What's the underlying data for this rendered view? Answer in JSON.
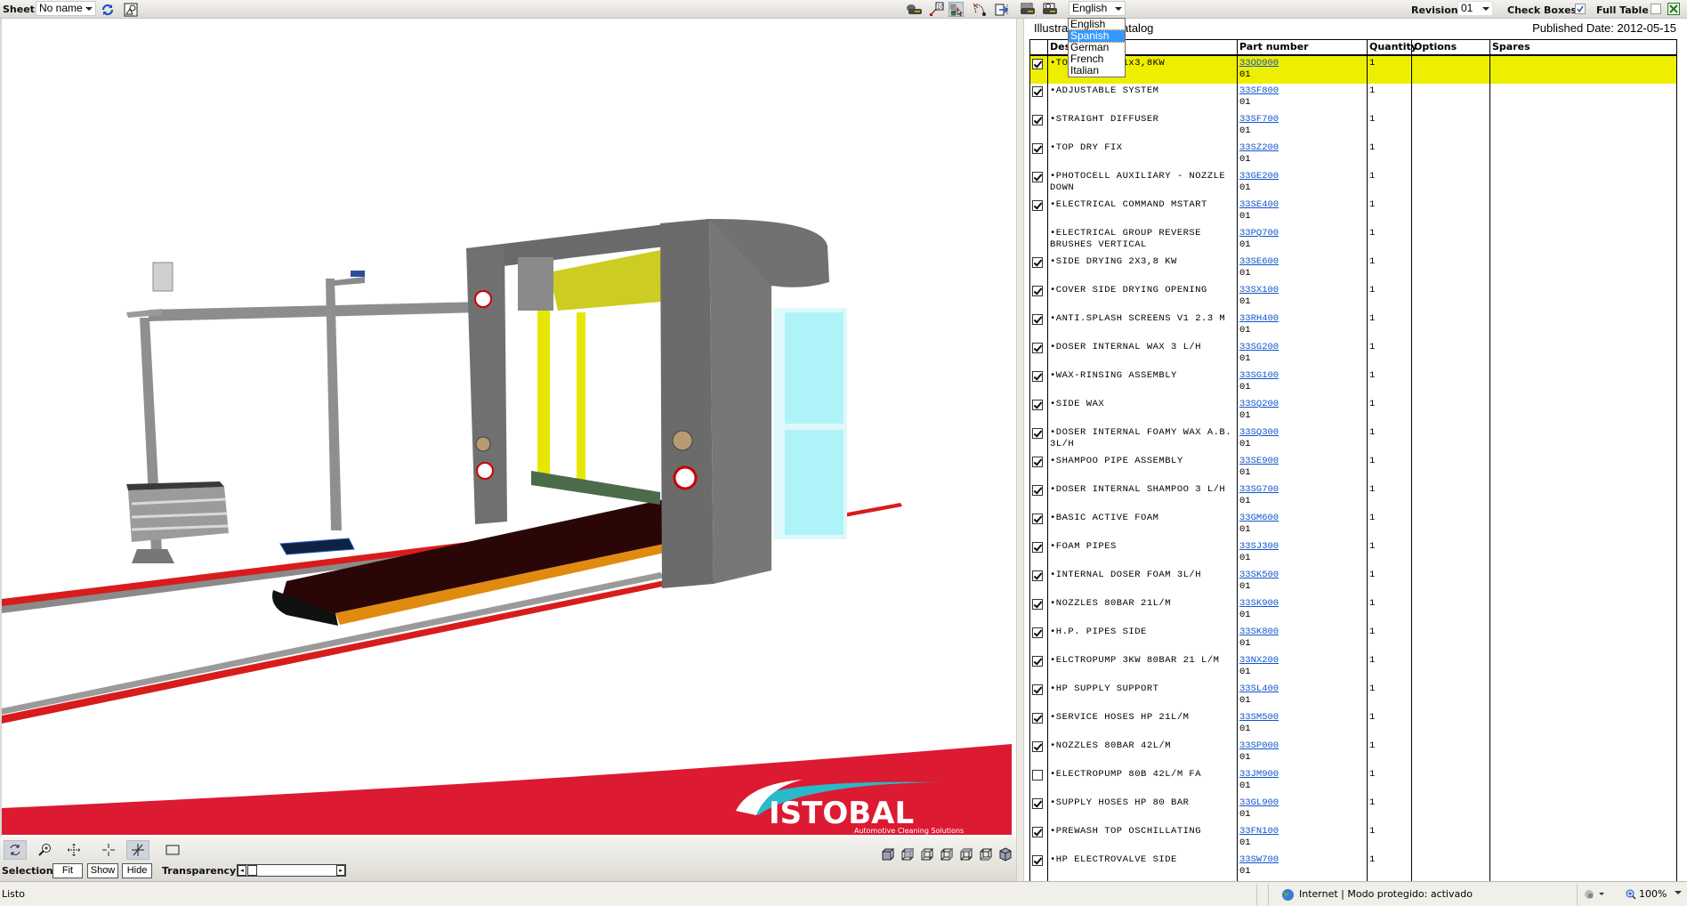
{
  "toolbar": {
    "sheet_label": "Sheet",
    "sheet_value": "No name",
    "language_value": "English",
    "language_options": [
      "English",
      "Spanish",
      "German",
      "French",
      "Italian"
    ],
    "language_highlighted": "Spanish",
    "revision_label": "Revision:",
    "revision_value": "01",
    "check_boxes_label": "Check Boxes",
    "check_boxes_checked": true,
    "full_table_label": "Full Table",
    "full_table_checked": false,
    "icons": [
      "refresh-icon",
      "shapes-icon",
      "printer-icon",
      "callout-10-icon",
      "select-part-icon",
      "path-icon",
      "export-icon",
      "print-table-icon",
      "print-preview-icon",
      "excel-export-icon"
    ]
  },
  "catalog": {
    "title": "Illustrated parts catalog",
    "published_date": "Published Date: 2012-05-15",
    "columns": [
      "",
      "Description",
      "Part number",
      "Quantity",
      "Options",
      "Spares"
    ],
    "rows": [
      {
        "checked": true,
        "desc": "•TOP DRYING 1x3,8KW",
        "part": "33QD900",
        "rev": "01",
        "qty": "1",
        "highlight": true
      },
      {
        "checked": true,
        "desc": "•ADJUSTABLE SYSTEM",
        "part": "33SF800",
        "rev": "01",
        "qty": "1"
      },
      {
        "checked": true,
        "desc": "•STRAIGHT DIFFUSER",
        "part": "33SF700",
        "rev": "01",
        "qty": "1"
      },
      {
        "checked": true,
        "desc": "•TOP DRY FIX",
        "part": "33SZ200",
        "rev": "01",
        "qty": "1"
      },
      {
        "checked": true,
        "desc": "•PHOTOCELL AUXILIARY - NOZZLE DOWN",
        "part": "33GE200",
        "rev": "01",
        "qty": "1"
      },
      {
        "checked": true,
        "desc": "•ELECTRICAL COMMAND MSTART",
        "part": "33SE400",
        "rev": "01",
        "qty": "1"
      },
      {
        "checked": null,
        "desc": "•ELECTRICAL GROUP REVERSE BRUSHES VERTICAL",
        "part": "33PQ700",
        "rev": "01",
        "qty": "1"
      },
      {
        "checked": true,
        "desc": "•SIDE DRYING 2X3,8 KW",
        "part": "33SE600",
        "rev": "01",
        "qty": "1"
      },
      {
        "checked": true,
        "desc": "•COVER SIDE DRYING OPENING",
        "part": "33SX100",
        "rev": "01",
        "qty": "1"
      },
      {
        "checked": true,
        "desc": "•ANTI.SPLASH SCREENS V1 2.3 M",
        "part": "33RH400",
        "rev": "01",
        "qty": "1"
      },
      {
        "checked": true,
        "desc": "•DOSER INTERNAL WAX 3 L/H",
        "part": "33SG200",
        "rev": "01",
        "qty": "1"
      },
      {
        "checked": true,
        "desc": "•WAX-RINSING ASSEMBLY",
        "part": "33SG100",
        "rev": "01",
        "qty": "1"
      },
      {
        "checked": true,
        "desc": "•SIDE WAX",
        "part": "33SQ200",
        "rev": "01",
        "qty": "1"
      },
      {
        "checked": true,
        "desc": "•DOSER INTERNAL FOAMY WAX A.B. 3L/H",
        "part": "33SQ300",
        "rev": "01",
        "qty": "1"
      },
      {
        "checked": true,
        "desc": "•SHAMPOO PIPE ASSEMBLY",
        "part": "33SE900",
        "rev": "01",
        "qty": "1"
      },
      {
        "checked": true,
        "desc": "•DOSER INTERNAL SHAMPOO 3 L/H",
        "part": "33SG700",
        "rev": "01",
        "qty": "1"
      },
      {
        "checked": true,
        "desc": "•BASIC ACTIVE FOAM",
        "part": "33GM600",
        "rev": "01",
        "qty": "1"
      },
      {
        "checked": true,
        "desc": "•FOAM PIPES",
        "part": "33SJ300",
        "rev": "01",
        "qty": "1"
      },
      {
        "checked": true,
        "desc": "•INTERNAL DOSER FOAM 3L/H",
        "part": "33SK500",
        "rev": "01",
        "qty": "1"
      },
      {
        "checked": true,
        "desc": "•NOZZLES 80BAR 21L/M",
        "part": "33SK900",
        "rev": "01",
        "qty": "1"
      },
      {
        "checked": true,
        "desc": "•H.P. PIPES SIDE",
        "part": "33SK800",
        "rev": "01",
        "qty": "1"
      },
      {
        "checked": true,
        "desc": "•ELCTROPUMP 3KW 80BAR 21 L/M",
        "part": "33NX200",
        "rev": "01",
        "qty": "1"
      },
      {
        "checked": true,
        "desc": "•HP SUPPLY SUPPORT",
        "part": "33SL400",
        "rev": "01",
        "qty": "1"
      },
      {
        "checked": true,
        "desc": "•SERVICE HOSES HP 21L/M",
        "part": "33SM500",
        "rev": "01",
        "qty": "1"
      },
      {
        "checked": true,
        "desc": "•NOZZLES 80BAR 42L/M",
        "part": "33SP000",
        "rev": "01",
        "qty": "1"
      },
      {
        "checked": false,
        "desc": "•ELECTROPUMP 80B 42L/M FA",
        "part": "33JM900",
        "rev": "01",
        "qty": "1"
      },
      {
        "checked": true,
        "desc": "•SUPPLY HOSES HP 80 BAR",
        "part": "33GL900",
        "rev": "01",
        "qty": "1"
      },
      {
        "checked": true,
        "desc": "•PREWASH TOP OSCHILLATING",
        "part": "33FN100",
        "rev": "01",
        "qty": "1"
      },
      {
        "checked": true,
        "desc": "•HP ELECTROVALVE SIDE",
        "part": "33SW700",
        "rev": "01",
        "qty": "1"
      }
    ]
  },
  "viewer": {
    "logo_text": "ISTOBAL",
    "logo_tagline": "Automotive Cleaning Solutions",
    "colors": {
      "brand_red": "#dc1a32",
      "brand_cyan": "#2bb8c8",
      "machine_gray": "#6e6e6e",
      "yellow": "#e6e600"
    },
    "tools": [
      "rotate-icon",
      "zoom-icon",
      "pan-icon",
      "center-icon",
      "section-icon",
      "frame-icon"
    ],
    "selection_label": "Selection:",
    "selection_buttons": [
      "Fit",
      "Show",
      "Hide"
    ],
    "transparency_label": "Transparency:",
    "transparency_value": 0,
    "view_cubes": [
      "view-front-icon",
      "view-back-icon",
      "view-left-icon",
      "view-right-icon",
      "view-top-icon",
      "view-bottom-icon",
      "view-iso-icon"
    ]
  },
  "statusbar": {
    "left": "Listo",
    "zone": "Internet | Modo protegido: activado",
    "zoom": "100%"
  }
}
